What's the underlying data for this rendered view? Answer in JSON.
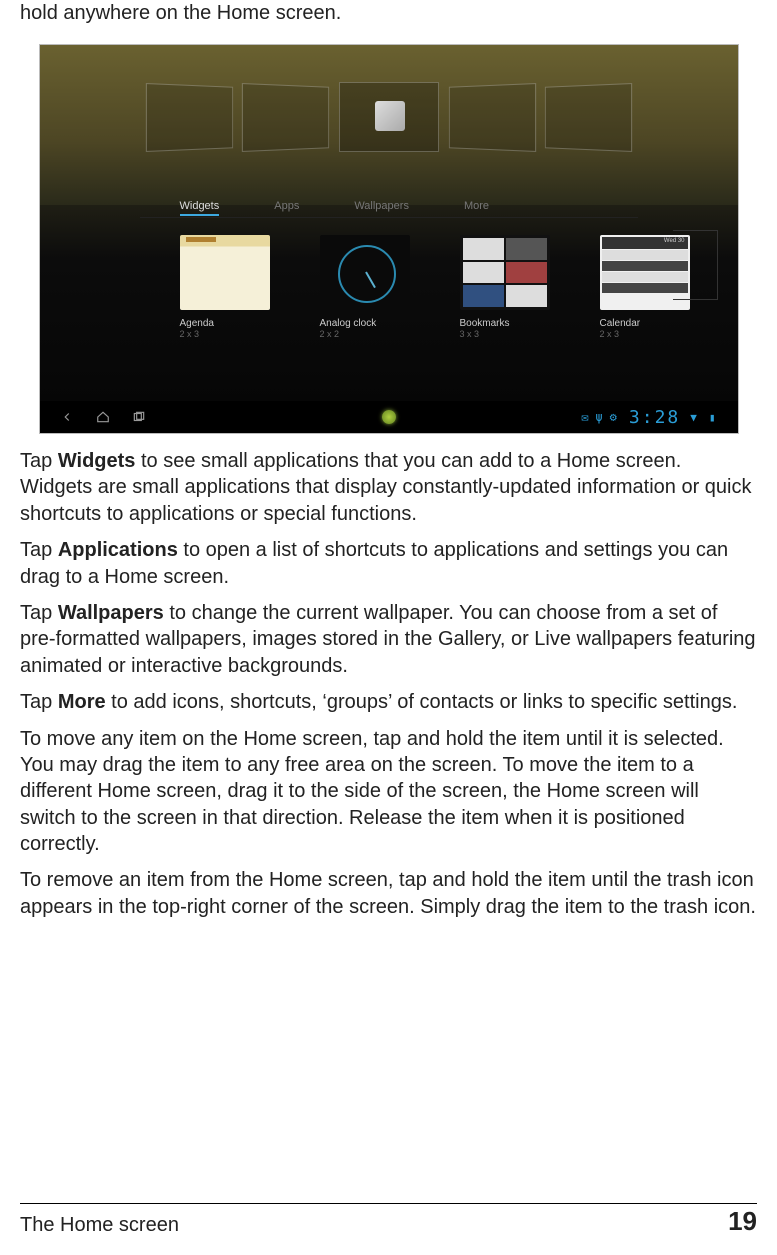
{
  "intro_line": "hold anywhere on the Home screen.",
  "screenshot": {
    "tabs": [
      "Widgets",
      "Apps",
      "Wallpapers",
      "More"
    ],
    "active_tab_index": 0,
    "widgets": [
      {
        "name": "Agenda",
        "dim": "2 x 3"
      },
      {
        "name": "Analog clock",
        "dim": "2 x 2"
      },
      {
        "name": "Bookmarks",
        "dim": "3 x 3"
      },
      {
        "name": "Calendar",
        "dim": "2 x 3"
      }
    ],
    "calendar_header": "Wed 30",
    "clock": "3:28"
  },
  "paragraphs": {
    "p1_pre": "Tap ",
    "p1_bold": "Widgets",
    "p1_post": " to see small applications that you can add to a Home screen. Widgets are small applications that display constantly-updated information or quick shortcuts to applications or special functions.",
    "p2_pre": "Tap ",
    "p2_bold": "Applications",
    "p2_post": " to open a list of shortcuts to applications and settings you can drag to a Home screen.",
    "p3_pre": "Tap ",
    "p3_bold": "Wallpapers",
    "p3_post": " to change the current wallpaper. You can choose from a set of pre-formatted wallpapers, images stored in the Gallery, or Live wallpapers featuring animated or interactive backgrounds.",
    "p4_pre": "Tap ",
    "p4_bold": "More",
    "p4_post": " to add icons, shortcuts, ‘groups’ of contacts or links to specific settings.",
    "p5": "To move any item on the Home screen, tap and hold the item until it is selected. You may drag the item to any free area on the screen. To move the item to a different Home screen, drag it to the side of the screen, the Home screen will switch to the screen in that direction. Release the item when it is positioned correctly.",
    "p6": "To remove an item from the Home screen, tap and hold the item until the trash icon appears in the top-right corner of the screen. Simply drag the item to the trash icon."
  },
  "footer": {
    "section": "The Home screen",
    "page": "19"
  }
}
